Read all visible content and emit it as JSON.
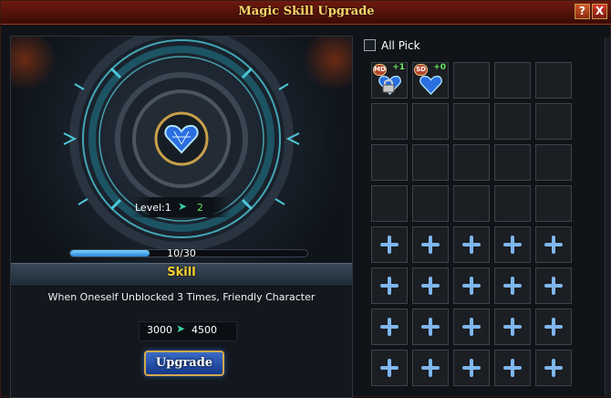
{
  "window": {
    "title": "Magic Skill Upgrade",
    "help_label": "?",
    "close_label": "X"
  },
  "left": {
    "level_label": "Level:1",
    "next_level": "2",
    "progress": {
      "text": "10/30",
      "current": 10,
      "max": 30
    },
    "skill_name": "Skill",
    "description": "When Oneself Unblocked 3 Times, Friendly Character",
    "cost_from": "3000",
    "cost_to": "4500",
    "upgrade_label": "Upgrade"
  },
  "right": {
    "all_pick_label": "All Pick",
    "all_pick_checked": false,
    "items": [
      {
        "badge": "MD",
        "count": "+1",
        "locked": true,
        "icon": "blue-crystal-heart-icon"
      },
      {
        "badge": "SD",
        "count": "+0",
        "locked": false,
        "icon": "blue-crystal-heart-icon"
      }
    ],
    "grid": {
      "columns": 5,
      "rows": 8,
      "empty_rows": 4
    }
  },
  "colors": {
    "accent": "#ffd030",
    "progress": "#4aa8f0",
    "plus": "#7fb6ee",
    "level_next": "#63e05a"
  }
}
